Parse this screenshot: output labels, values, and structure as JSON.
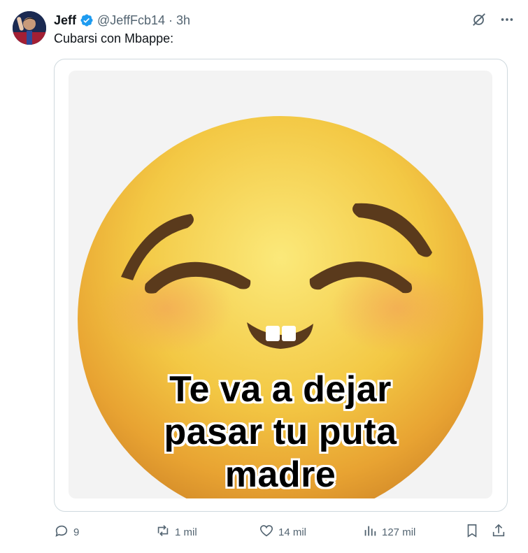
{
  "tweet": {
    "author_name": "Jeff",
    "handle": "@JeffFcb14",
    "separator": "·",
    "time": "3h",
    "text": "Cubarsi con Mbappe:",
    "verified": true
  },
  "media": {
    "caption_lines": [
      "Te va a dejar",
      "pasar tu puta",
      "madre"
    ]
  },
  "actions": {
    "replies": "9",
    "reposts": "1 mil",
    "likes": "14 mil",
    "views": "127 mil"
  },
  "icons": {
    "grok": "grok-icon",
    "more": "more-icon",
    "reply": "reply-icon",
    "repost": "repost-icon",
    "like": "heart-icon",
    "views": "views-icon",
    "bookmark": "bookmark-icon",
    "share": "share-icon"
  },
  "colors": {
    "verified": "#1d9bf0",
    "secondary_text": "#536471",
    "primary_text": "#0f1419",
    "border": "#cfd9de"
  }
}
